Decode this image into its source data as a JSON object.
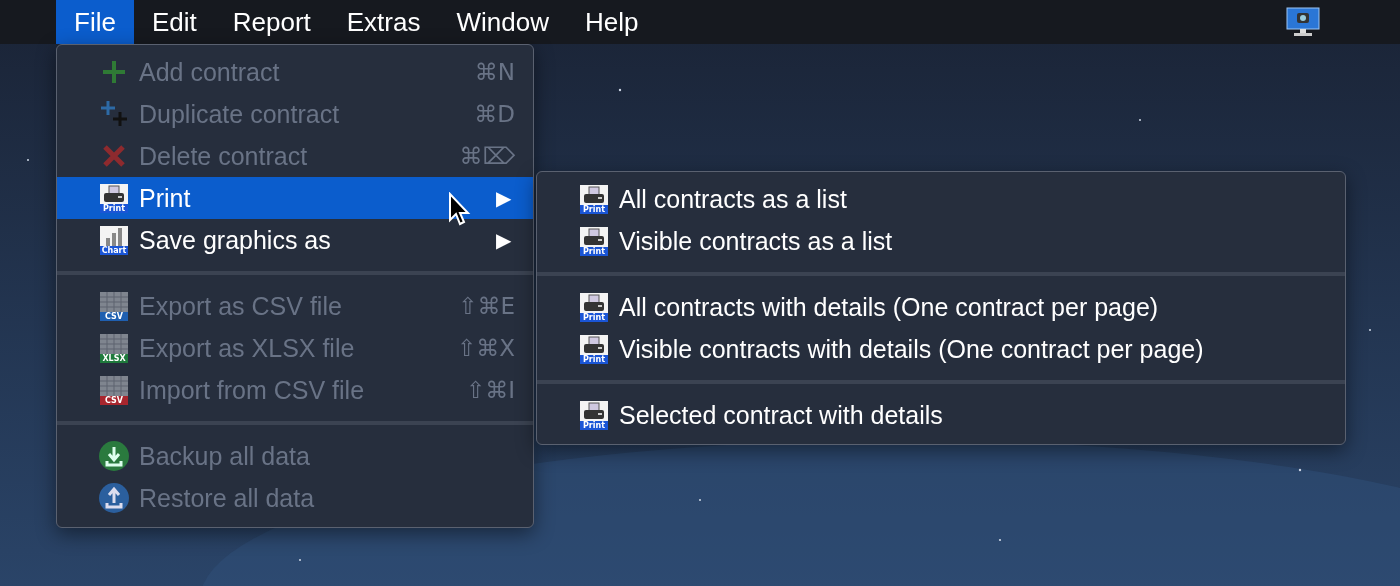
{
  "menubar": {
    "menus": [
      {
        "label": "File",
        "selected": true
      },
      {
        "label": "Edit",
        "selected": false
      },
      {
        "label": "Report",
        "selected": false
      },
      {
        "label": "Extras",
        "selected": false
      },
      {
        "label": "Window",
        "selected": false
      },
      {
        "label": "Help",
        "selected": false
      }
    ]
  },
  "file_menu": {
    "sections": [
      [
        {
          "label": "Add contract",
          "kind": "plus",
          "shortcut": "⌘N",
          "disabled": true,
          "selected": false
        },
        {
          "label": "Duplicate contract",
          "kind": "duplicate",
          "shortcut": "⌘D",
          "disabled": true,
          "selected": false
        },
        {
          "label": "Delete contract",
          "kind": "delete",
          "shortcut": "⌘⌦",
          "disabled": true,
          "selected": false
        },
        {
          "label": "Print",
          "kind": "print",
          "badge": "Print",
          "arrow": "▶",
          "disabled": false,
          "selected": true
        },
        {
          "label": "Save graphics as",
          "kind": "chart",
          "badge": "Chart",
          "arrow": "▶",
          "disabled": false,
          "selected": false
        }
      ],
      [
        {
          "label": "Export as CSV file",
          "kind": "sheet",
          "badge": "CSV",
          "color": "#1f5fb0",
          "shortcut": "⇧⌘E",
          "disabled": true,
          "selected": false
        },
        {
          "label": "Export as XLSX file",
          "kind": "sheet",
          "badge": "XLSX",
          "color": "#1e7a3c",
          "shortcut": "⇧⌘X",
          "disabled": true,
          "selected": false
        },
        {
          "label": "Import from CSV file",
          "kind": "sheet",
          "badge": "CSV",
          "color": "#a8262e",
          "shortcut": "⇧⌘I",
          "disabled": true,
          "selected": false
        }
      ],
      [
        {
          "label": "Backup all data",
          "kind": "backup",
          "disabled": true,
          "selected": false
        },
        {
          "label": "Restore all data",
          "kind": "restore",
          "disabled": true,
          "selected": false
        }
      ]
    ]
  },
  "print_submenu": {
    "sections": [
      [
        {
          "label": "All contracts as a list",
          "kind": "print",
          "badge": "Print",
          "disabled": false,
          "selected": false
        },
        {
          "label": "Visible contracts as a list",
          "kind": "print",
          "badge": "Print",
          "disabled": false,
          "selected": false
        }
      ],
      [
        {
          "label": "All contracts with details (One contract per page)",
          "kind": "print",
          "badge": "Print",
          "disabled": false,
          "selected": false
        },
        {
          "label": "Visible contracts with details (One contract per page)",
          "kind": "print",
          "badge": "Print",
          "disabled": false,
          "selected": false
        }
      ],
      [
        {
          "label": "Selected contract with details",
          "kind": "print",
          "badge": "Print",
          "disabled": false,
          "selected": false
        }
      ]
    ]
  }
}
